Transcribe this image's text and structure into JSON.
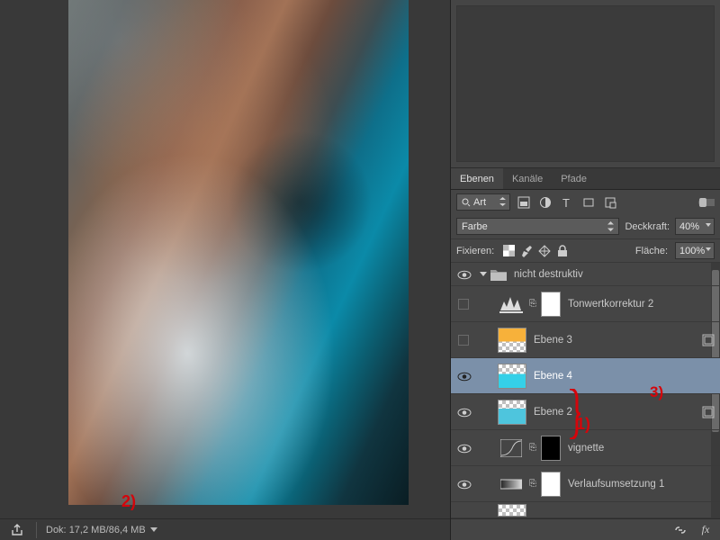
{
  "statusbar": {
    "doc_label": "Dok:",
    "doc_size": "17,2 MB/86,4 MB"
  },
  "tabs": {
    "layers": "Ebenen",
    "channels": "Kanäle",
    "paths": "Pfade"
  },
  "filter": {
    "kind_label": "Art"
  },
  "blend": {
    "mode": "Farbe",
    "opacity_label": "Deckkraft:",
    "opacity": "40%",
    "fill_label": "Fläche:",
    "fill": "100%"
  },
  "lock": {
    "label": "Fixieren:"
  },
  "group": {
    "name": "nicht destruktiv"
  },
  "layers": {
    "levels": {
      "name": "Tonwertkorrektur 2"
    },
    "ebene3": {
      "name": "Ebene 3"
    },
    "ebene4": {
      "name": "Ebene 4"
    },
    "ebene2": {
      "name": "Ebene 2"
    },
    "vignette": {
      "name": "vignette"
    },
    "gradmap": {
      "name": "Verlaufsumsetzung 1"
    }
  },
  "annotations": {
    "a1": "1)",
    "a2": "2)",
    "a3": "3)"
  },
  "bottombar": {
    "fx": "fx"
  }
}
